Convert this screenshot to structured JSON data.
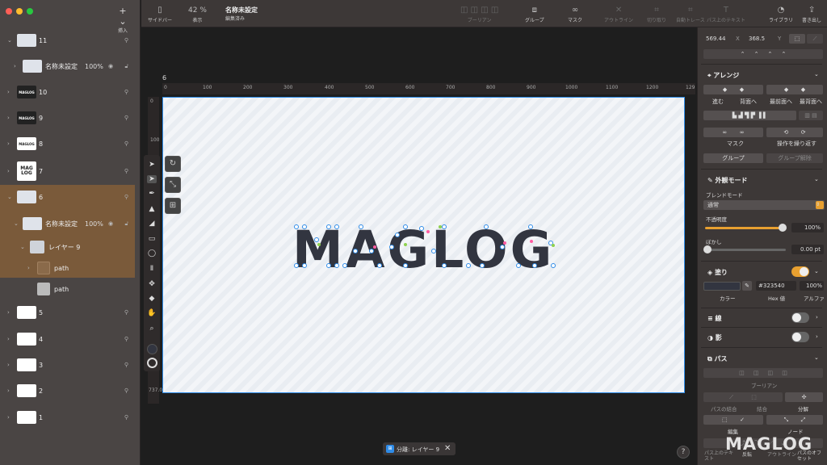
{
  "toolbar": {
    "insert": "挿入",
    "sidebar": "サイドバー",
    "view": "表示",
    "zoom": "42 %",
    "doc_title": "名称未設定",
    "doc_status": "編集済み",
    "boolean": "ブーリアン",
    "group": "グループ",
    "mask": "マスク",
    "outline": "アウトライン",
    "crop": "切り取り",
    "autotrace": "自動トレース",
    "text_on_path": "パス上のテキスト",
    "library": "ライブラリ",
    "export": "書き出し"
  },
  "layers": [
    {
      "name": "11",
      "thumb": ""
    },
    {
      "name": "名称未設定",
      "thumb": "",
      "pct": "100%"
    },
    {
      "name": "10",
      "thumb": "MAGLOG"
    },
    {
      "name": "9",
      "thumb": "MAGLOG"
    },
    {
      "name": "8",
      "thumb": "MAGLOG"
    },
    {
      "name": "7",
      "thumb": "MAG LOG"
    },
    {
      "name": "6",
      "thumb": ""
    },
    {
      "name": "名称未設定",
      "thumb": "",
      "pct": "100%"
    },
    {
      "name": "レイヤー 9",
      "thumb": ""
    },
    {
      "name": "path",
      "thumb": ""
    },
    {
      "name": "path",
      "thumb": ""
    },
    {
      "name": "5",
      "thumb": ""
    },
    {
      "name": "4",
      "thumb": ""
    },
    {
      "name": "3",
      "thumb": ""
    },
    {
      "name": "2",
      "thumb": ""
    },
    {
      "name": "1",
      "thumb": ""
    }
  ],
  "canvas": {
    "artboard_label": "6",
    "artboard_text": "MAGLOG",
    "ruler_h": [
      "0",
      "100",
      "200",
      "300",
      "400",
      "500",
      "600",
      "700",
      "800",
      "900",
      "1000",
      "1100",
      "1200",
      "129"
    ],
    "ruler_v": [
      "0",
      "100",
      "737.0"
    ],
    "status": "分離: レイヤー 9",
    "help": "?"
  },
  "inspector": {
    "x": "569.44",
    "x_label": "X",
    "y": "368.5",
    "y_label": "Y",
    "arrange": "アレンジ",
    "arrange_buttons": [
      "進む",
      "背面へ",
      "最前面へ",
      "最背面へ"
    ],
    "mask": "マスク",
    "repeat": "操作を繰り返す",
    "group": "グループ",
    "ungroup": "グループ解除",
    "appearance": "外観モード",
    "blend_mode_label": "ブレンドモード",
    "blend_mode": "通常",
    "opacity_label": "不透明度",
    "opacity": "100%",
    "opacity_value": 1.0,
    "blur_label": "ぼかし",
    "blur": "0.00 pt",
    "fill": "塗り",
    "fill_color": "#323540",
    "fill_hex": "#323540",
    "fill_alpha": "100%",
    "color_label": "カラー",
    "hex_label": "Hex 値",
    "alpha_label": "アルファ",
    "stroke": "線",
    "shadow": "影",
    "path": "パス",
    "boolean": "ブーリアン",
    "combine": "パスの結合",
    "merge": "結合",
    "split": "分解",
    "edit": "編集",
    "node": "ノード",
    "text_on_path": "パス上のテキスト",
    "rotate": "反転",
    "outline": "アウトライン",
    "offset": "パスのオフセット"
  },
  "watermark": "MAGLOG",
  "colors": {
    "accent": "#2f8ce8",
    "selection": "#7a5a3a",
    "toggle_on": "#e8a030",
    "logo": "#323540"
  }
}
